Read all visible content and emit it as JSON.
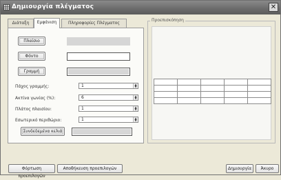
{
  "window": {
    "title": "Δημιουργία πλέγματος",
    "close_glyph": "✕"
  },
  "tabs": [
    {
      "label": "Διάταξη"
    },
    {
      "label": "Εμφάνιση",
      "active": true
    },
    {
      "label": "Πληροφορίες Πλέγματος"
    }
  ],
  "appearance": {
    "background_button": "Πλαίσιο",
    "background_color": "#d6d6d6",
    "font_button": "Φόντο",
    "font_color": "#ffffff",
    "line_button": "Γραμμή",
    "line_color": "#d6d6d6",
    "fields": [
      {
        "label": "Πάχος γραμμής:",
        "value": "1"
      },
      {
        "label": "Ακτίνα γωνίας (%):",
        "value": "6"
      },
      {
        "label": "Πλάτος πλαισίου:",
        "value": "1"
      },
      {
        "label": "Εσωτερικό περιθώριο:",
        "value": "1"
      }
    ],
    "linked_cells_button": "Συνδεδεμένα κελιά",
    "linked_cells_color": "#d6d6d6"
  },
  "preview": {
    "legend": "Προεπισκόπηση",
    "rows": 4,
    "cols": 5
  },
  "buttons": {
    "load_preset": "Φόρτωση προεπιλογών",
    "save_preset": "Αποθήκευση προεπιλογών",
    "create": "Δημιουργία",
    "cancel": "Άκυρο"
  },
  "icons": {
    "title_icon": "grid-icon",
    "spin_icon": "spin-arrows-icon"
  }
}
